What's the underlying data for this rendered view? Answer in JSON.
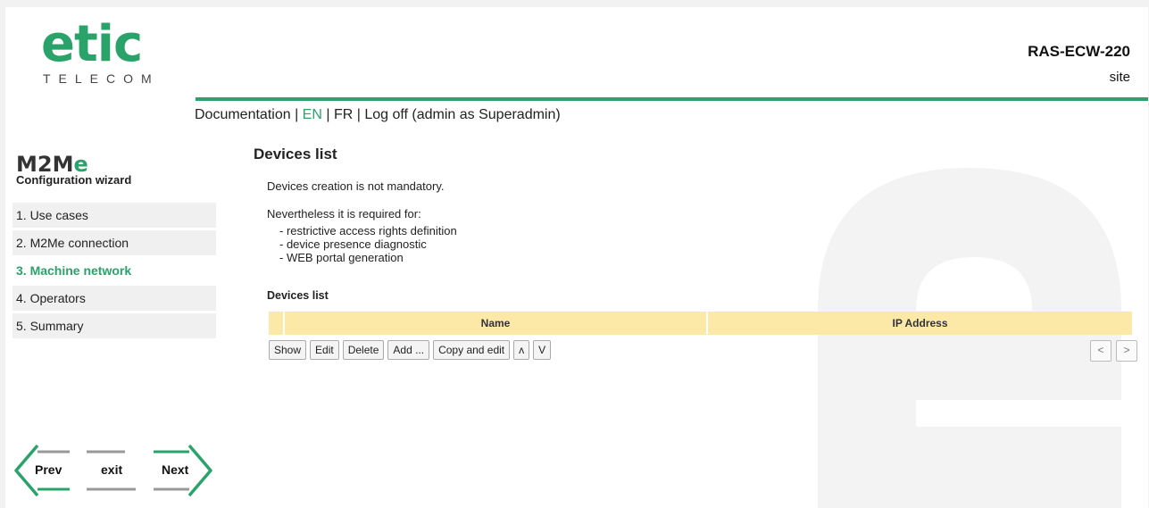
{
  "brand": {
    "logo_text": "etic",
    "logo_sub": "TELECOM"
  },
  "device": {
    "model": "RAS-ECW-220",
    "site": "site"
  },
  "topnav": {
    "documentation": "Documentation",
    "sep1": " | ",
    "lang_en": "EN",
    "sep2": " | ",
    "lang_fr": "FR",
    "sep3": " | ",
    "logoff": "Log off (admin as Superadmin)"
  },
  "wizard": {
    "logo_m2": "M2M",
    "logo_e": "e",
    "subtitle": "Configuration wizard",
    "steps": [
      {
        "label": "1. Use cases",
        "active": false
      },
      {
        "label": "2. M2Me connection",
        "active": false
      },
      {
        "label": "3. Machine network",
        "active": true
      },
      {
        "label": "4. Operators",
        "active": false
      },
      {
        "label": "5. Summary",
        "active": false
      }
    ]
  },
  "main": {
    "title": "Devices list",
    "intro": "Devices creation is not mandatory.",
    "required_for": "Nevertheless it is required for:",
    "reasons": [
      "- restrictive access rights definition",
      "- device presence diagnostic",
      "- WEB portal generation"
    ],
    "list_title": "Devices list",
    "table": {
      "columns": [
        "Name",
        "IP Address"
      ],
      "rows": []
    },
    "buttons": {
      "show": "Show",
      "edit": "Edit",
      "delete": "Delete",
      "add": "Add ...",
      "copy_edit": "Copy and edit",
      "up": "ʌ",
      "down": "V"
    },
    "pager": {
      "prev": "<",
      "next": ">"
    }
  },
  "navigation": {
    "prev": "Prev",
    "exit": "exit",
    "next": "Next"
  },
  "colors": {
    "accent": "#2aa36b",
    "table_header": "#fce9a8"
  }
}
